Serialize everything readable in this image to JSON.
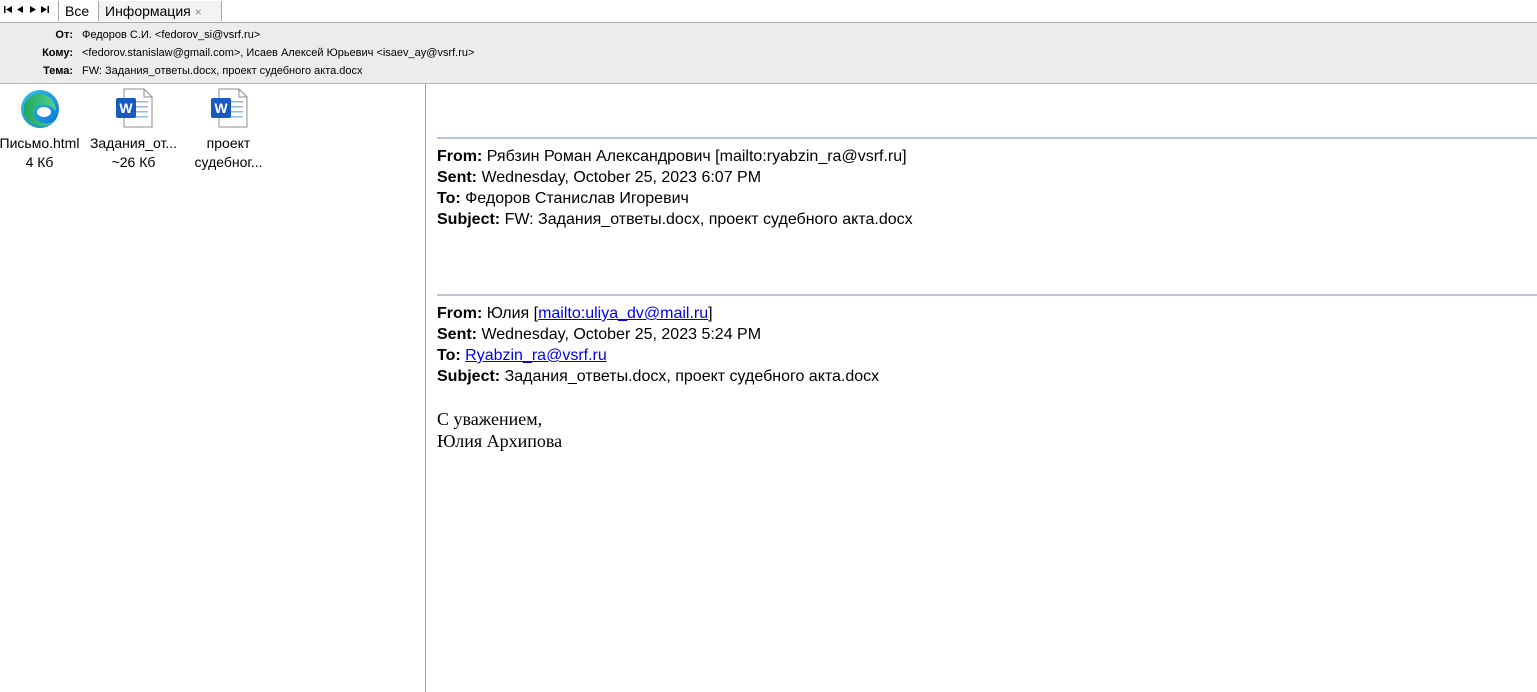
{
  "tabs": {
    "all_label": "Все",
    "info_label": "Информация",
    "close_symbol": "×"
  },
  "nav": {
    "first": "◀",
    "prev": "◀",
    "next": "▶",
    "last": "▶"
  },
  "header": {
    "from_label": "От:",
    "from_value": "Федоров С.И. <fedorov_si@vsrf.ru>",
    "to_label": "Кому:",
    "to_value": "<fedorov.stanislaw@gmail.com>, Исаев Алексей Юрьевич <isaev_ay@vsrf.ru>",
    "subject_label": "Тема:",
    "subject_value": "FW: Задания_ответы.docx, проект судебного акта.docx"
  },
  "attachments": [
    {
      "icon": "edge-browser-icon",
      "name": "Письмо.html",
      "size": "4 Кб"
    },
    {
      "icon": "word-document-icon",
      "name": "Задания_от...",
      "size": "~26 Кб"
    },
    {
      "icon": "word-document-icon",
      "name": "проект",
      "size": "судебног..."
    }
  ],
  "message": {
    "first": {
      "from_label": "From:",
      "from_value": "Рябзин Роман Александрович [mailto:ryabzin_ra@vsrf.ru]",
      "sent_label": "Sent:",
      "sent_value": "Wednesday, October 25, 2023 6:07 PM",
      "to_label": "To:",
      "to_value": "Федоров Станислав Игоревич",
      "subject_label": "Subject:",
      "subject_value": "FW: Задания_ответы.docx, проект судебного акта.docx"
    },
    "second": {
      "from_label": "From:",
      "from_name": "Юлия",
      "from_open": "[",
      "from_link": "mailto:uliya_dv@mail.ru",
      "from_close": "]",
      "sent_label": "Sent:",
      "sent_value": "Wednesday, October 25, 2023 5:24 PM",
      "to_label": "To:",
      "to_link": "Ryabzin_ra@vsrf.ru",
      "subject_label": "Subject:",
      "subject_value": "Задания_ответы.docx, проект судебного акта.docx"
    },
    "signature_line1": "С уважением,",
    "signature_line2": "Юлия Архипова"
  },
  "colors": {
    "word_blue": "#185abd",
    "separator": "#b5c4df",
    "header_bg": "#ececec",
    "link": "#0000ee"
  }
}
